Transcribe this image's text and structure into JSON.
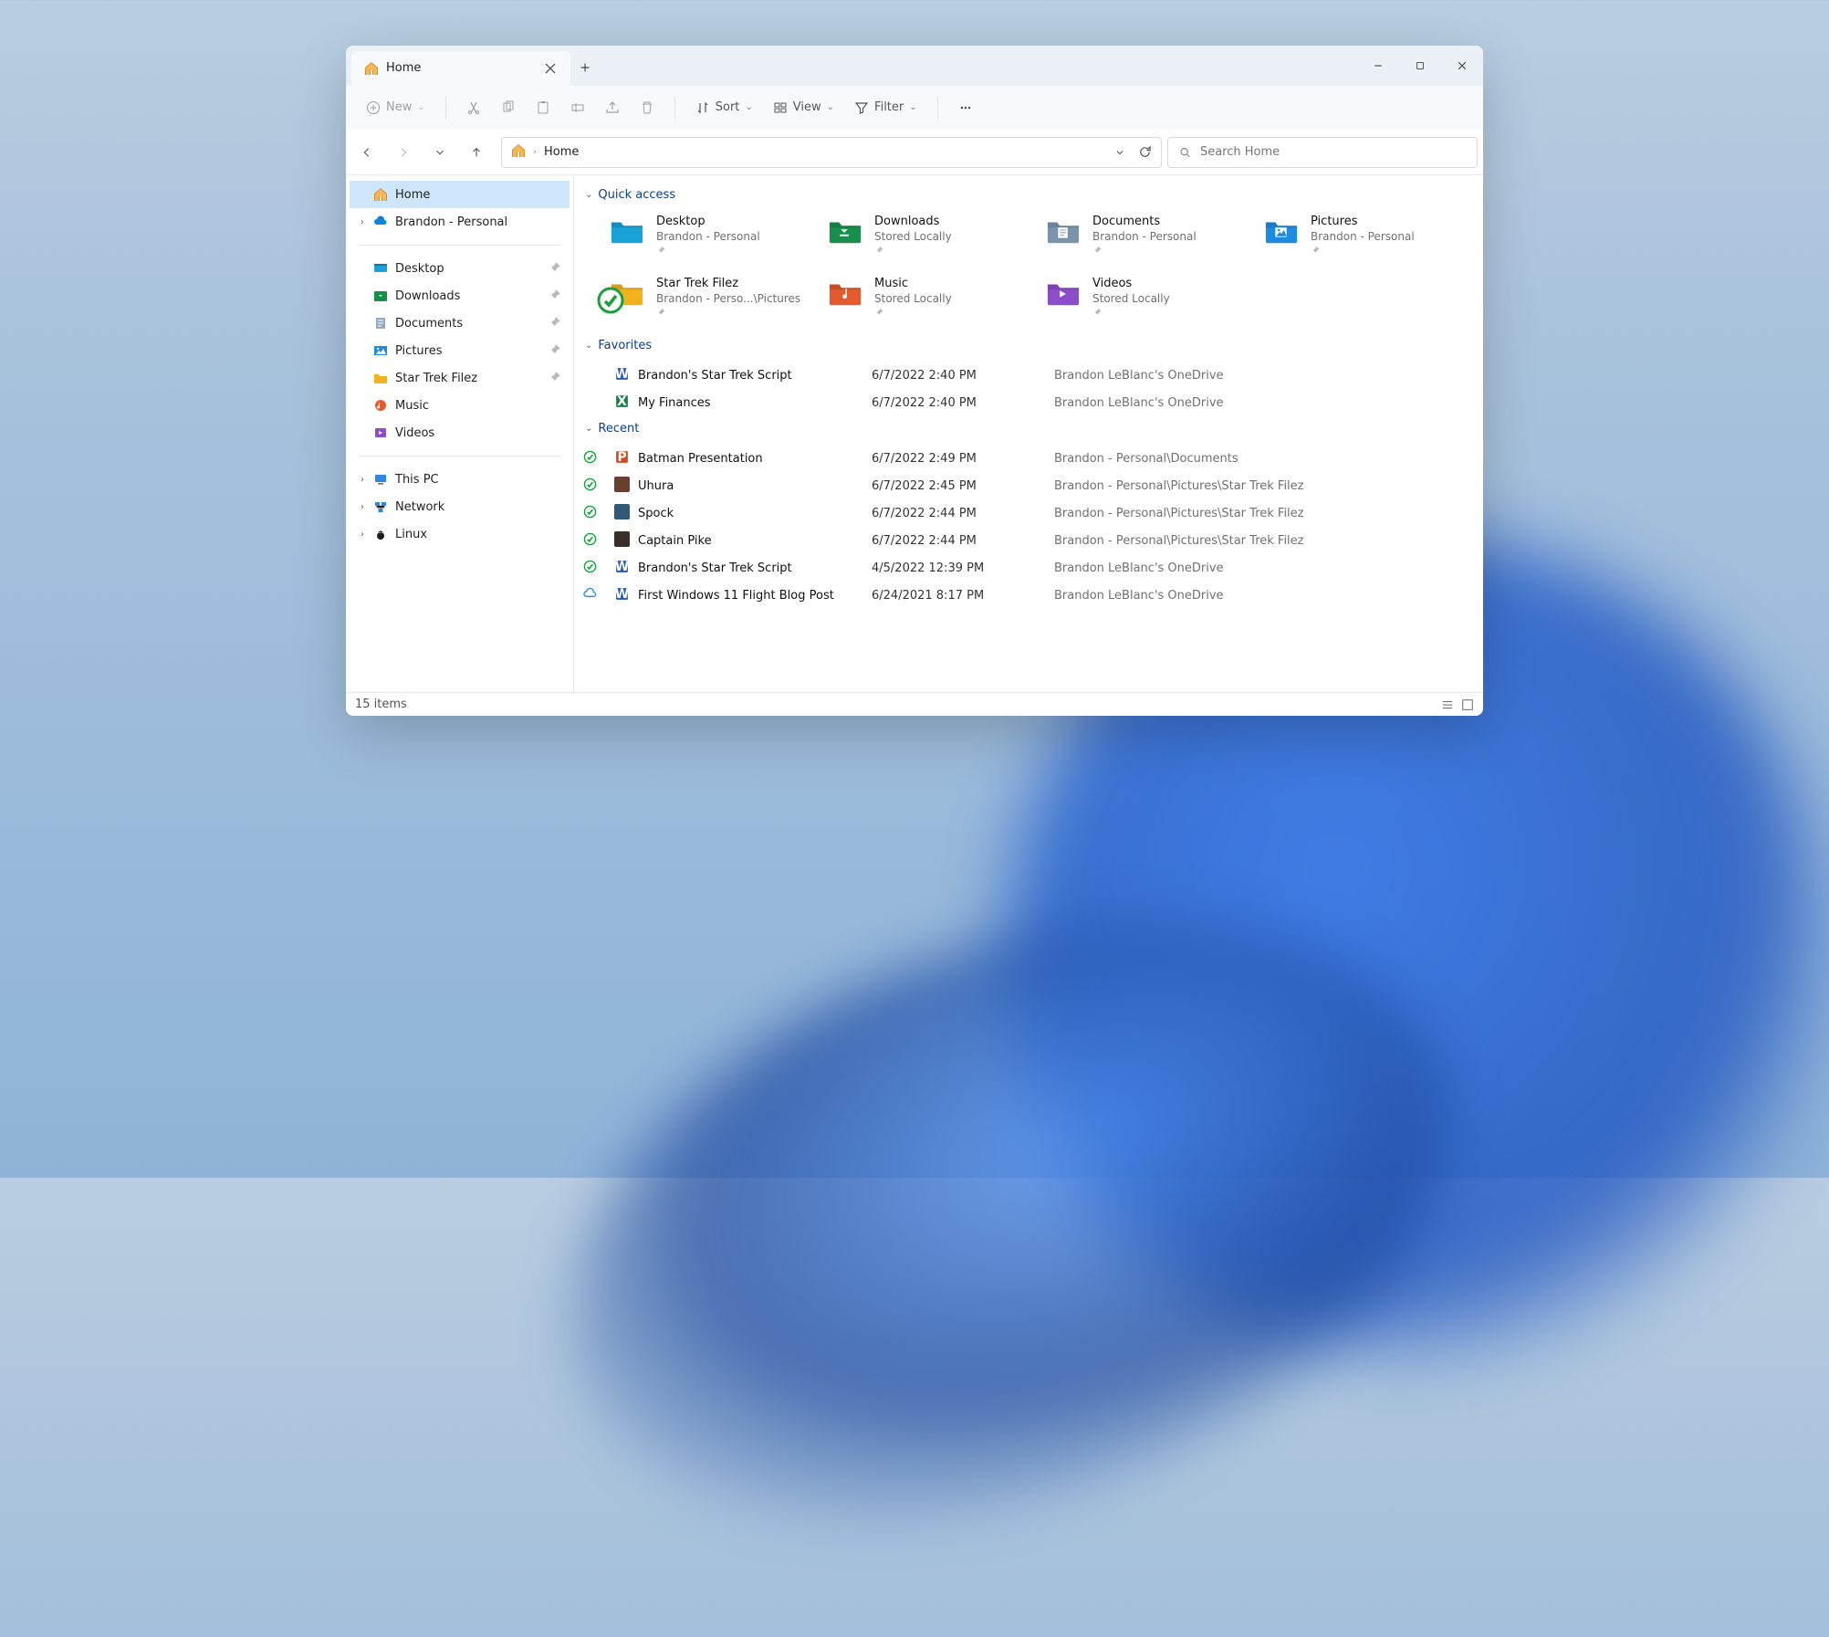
{
  "tab": {
    "title": "Home"
  },
  "toolbar": {
    "new": "New",
    "sort": "Sort",
    "view": "View",
    "filter": "Filter"
  },
  "breadcrumb": "Home",
  "search": {
    "placeholder": "Search Home"
  },
  "sidebar": {
    "items": [
      {
        "label": "Home",
        "icon": "home",
        "active": true
      },
      {
        "label": "Brandon - Personal",
        "icon": "onedrive",
        "expander": true
      },
      {
        "label": "Desktop",
        "icon": "desktop",
        "pinned": true
      },
      {
        "label": "Downloads",
        "icon": "downloads",
        "pinned": true
      },
      {
        "label": "Documents",
        "icon": "documents",
        "pinned": true
      },
      {
        "label": "Pictures",
        "icon": "pictures",
        "pinned": true
      },
      {
        "label": "Star Trek Filez",
        "icon": "folder",
        "pinned": true
      },
      {
        "label": "Music",
        "icon": "music"
      },
      {
        "label": "Videos",
        "icon": "videos"
      },
      {
        "label": "This PC",
        "icon": "pc",
        "expander": true
      },
      {
        "label": "Network",
        "icon": "network",
        "expander": true
      },
      {
        "label": "Linux",
        "icon": "linux",
        "expander": true
      }
    ]
  },
  "sections": {
    "quick": {
      "title": "Quick access",
      "items": [
        {
          "name": "Desktop",
          "loc": "Brandon - Personal",
          "color": "#18a2d8",
          "icon": "desktop"
        },
        {
          "name": "Downloads",
          "loc": "Stored Locally",
          "color": "#178f4a",
          "icon": "downloads"
        },
        {
          "name": "Documents",
          "loc": "Brandon - Personal",
          "color": "#7c94ab",
          "icon": "documents"
        },
        {
          "name": "Pictures",
          "loc": "Brandon - Personal",
          "color": "#1f8be0",
          "icon": "pictures"
        },
        {
          "name": "Star Trek Filez",
          "loc": "Brandon - Perso...\\Pictures",
          "color": "#f2b21c",
          "icon": "folder",
          "sync": true
        },
        {
          "name": "Music",
          "loc": "Stored Locally",
          "color": "#e35b2e",
          "icon": "music"
        },
        {
          "name": "Videos",
          "loc": "Stored Locally",
          "color": "#8c4ec8",
          "icon": "videos"
        }
      ]
    },
    "favorites": {
      "title": "Favorites",
      "items": [
        {
          "name": "Brandon's Star Trek Script",
          "date": "6/7/2022 2:40 PM",
          "loc": "Brandon LeBlanc's OneDrive",
          "ftype": "word"
        },
        {
          "name": "My Finances",
          "date": "6/7/2022 2:40 PM",
          "loc": "Brandon LeBlanc's OneDrive",
          "ftype": "excel"
        }
      ]
    },
    "recent": {
      "title": "Recent",
      "items": [
        {
          "name": "Batman Presentation",
          "date": "6/7/2022 2:49 PM",
          "loc": "Brandon - Personal\\Documents",
          "ftype": "ppt",
          "status": "sync"
        },
        {
          "name": "Uhura",
          "date": "6/7/2022 2:45 PM",
          "loc": "Brandon - Personal\\Pictures\\Star Trek Filez",
          "ftype": "image",
          "imgcolor": "#6b3f2e",
          "status": "sync"
        },
        {
          "name": "Spock",
          "date": "6/7/2022 2:44 PM",
          "loc": "Brandon - Personal\\Pictures\\Star Trek Filez",
          "ftype": "image",
          "imgcolor": "#2e5a78",
          "status": "sync"
        },
        {
          "name": "Captain Pike",
          "date": "6/7/2022 2:44 PM",
          "loc": "Brandon - Personal\\Pictures\\Star Trek Filez",
          "ftype": "image",
          "imgcolor": "#3a2f28",
          "status": "sync"
        },
        {
          "name": "Brandon's Star Trek Script",
          "date": "4/5/2022 12:39 PM",
          "loc": "Brandon LeBlanc's OneDrive",
          "ftype": "word",
          "status": "sync"
        },
        {
          "name": "First Windows 11 Flight Blog Post",
          "date": "6/24/2021 8:17 PM",
          "loc": "Brandon LeBlanc's OneDrive",
          "ftype": "word",
          "status": "cloud"
        }
      ]
    }
  },
  "status": {
    "count": "15 items"
  }
}
